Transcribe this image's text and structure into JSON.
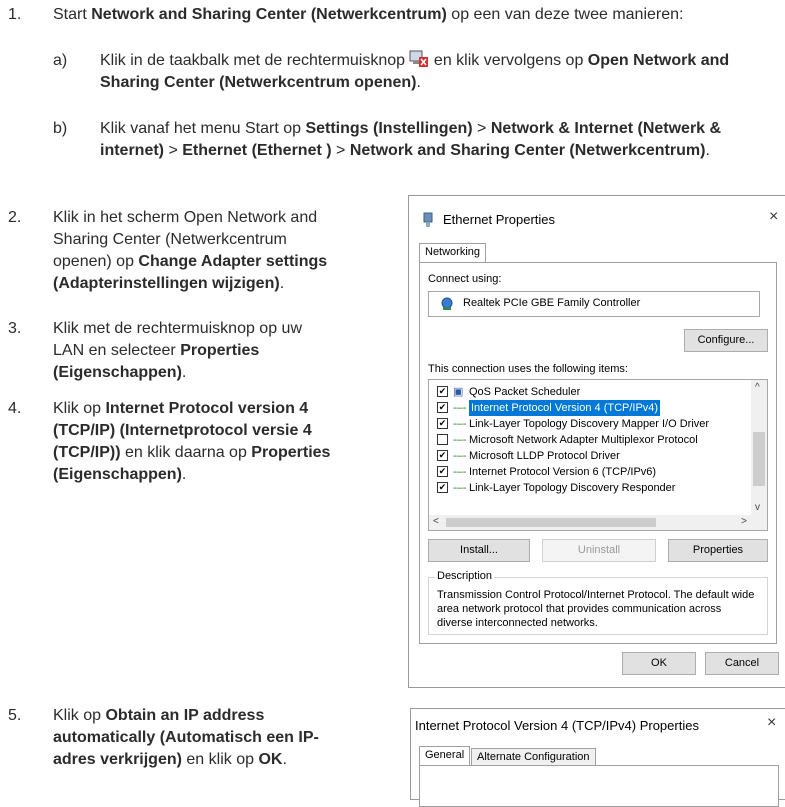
{
  "steps": [
    {
      "num": "1.",
      "parts": [
        {
          "t": "Start "
        },
        {
          "b": "Network and Sharing Center (Netwerkcentrum)"
        },
        {
          "t": " op een van deze twee manieren:"
        }
      ]
    },
    {
      "letter": "a)",
      "parts": [
        {
          "t": "Klik in de taakbalk met de rechtermuisknop "
        },
        {
          "icon": "network-tray-icon"
        },
        {
          "t": " en klik vervolgens op "
        },
        {
          "b": "Open Network and Sharing Center (Netwerkcentrum openen)"
        },
        {
          "t": "."
        }
      ]
    },
    {
      "letter": "b)",
      "parts": [
        {
          "t": "Klik vanaf het menu Start op "
        },
        {
          "b": "Settings (Instellingen)"
        },
        {
          "t": " > "
        },
        {
          "b": "Network & Internet (Netwerk & internet)"
        },
        {
          "t": " > "
        },
        {
          "b": "Ethernet (Ethernet )"
        },
        {
          "t": " > "
        },
        {
          "b": "Network and Sharing Center (Netwerkcentrum)"
        },
        {
          "t": "."
        }
      ]
    },
    {
      "num": "2.",
      "parts": [
        {
          "t": "Klik in het scherm Open Network and Sharing Center (Netwerkcentrum openen) op "
        },
        {
          "b": "Change Adapter settings (Adapterinstellingen wijzigen)"
        },
        {
          "t": "."
        }
      ]
    },
    {
      "num": "3.",
      "parts": [
        {
          "t": "Klik met de rechtermuisknop op uw LAN en selecteer "
        },
        {
          "b": "Properties (Eigenschappen)"
        },
        {
          "t": "."
        }
      ]
    },
    {
      "num": "4.",
      "parts": [
        {
          "t": "Klik op "
        },
        {
          "b": "Internet Protocol version 4 (TCP/IP) (Internetprotocol versie 4 (TCP/IP))"
        },
        {
          "t": " en klik daarna op "
        },
        {
          "b": "Properties (Eigenschappen)"
        },
        {
          "t": "."
        }
      ]
    },
    {
      "num": "5.",
      "parts": [
        {
          "t": "Klik op "
        },
        {
          "b": "Obtain an IP address automatically (Automatisch een IP-adres verkrijgen)"
        },
        {
          "t": " en klik op "
        },
        {
          "b": "OK"
        },
        {
          "t": "."
        }
      ]
    }
  ],
  "ethernet_dialog": {
    "title": "Ethernet Properties",
    "tab": "Networking",
    "connect_using": "Connect using:",
    "adapter": "Realtek PCIe GBE Family Controller",
    "configure": "Configure...",
    "items_label": "This connection uses the following items:",
    "items": [
      {
        "checked": true,
        "label": "QoS Packet Scheduler",
        "selected": false
      },
      {
        "checked": true,
        "label": "Internet Protocol Version 4 (TCP/IPv4)",
        "selected": true
      },
      {
        "checked": true,
        "label": "Link-Layer Topology Discovery Mapper I/O Driver",
        "selected": false
      },
      {
        "checked": false,
        "label": "Microsoft Network Adapter Multiplexor Protocol",
        "selected": false
      },
      {
        "checked": true,
        "label": "Microsoft LLDP Protocol Driver",
        "selected": false
      },
      {
        "checked": true,
        "label": "Internet Protocol Version 6 (TCP/IPv6)",
        "selected": false
      },
      {
        "checked": true,
        "label": "Link-Layer Topology Discovery Responder",
        "selected": false
      }
    ],
    "install": "Install...",
    "uninstall": "Uninstall",
    "properties": "Properties",
    "description_title": "Description",
    "description": "Transmission Control Protocol/Internet Protocol. The default wide area network protocol that provides communication across diverse interconnected networks.",
    "ok": "OK",
    "cancel": "Cancel"
  },
  "ipv4_dialog": {
    "title": "Internet Protocol Version 4 (TCP/IPv4) Properties",
    "tab_general": "General",
    "tab_alternate": "Alternate Configuration"
  },
  "close_glyph": "×"
}
